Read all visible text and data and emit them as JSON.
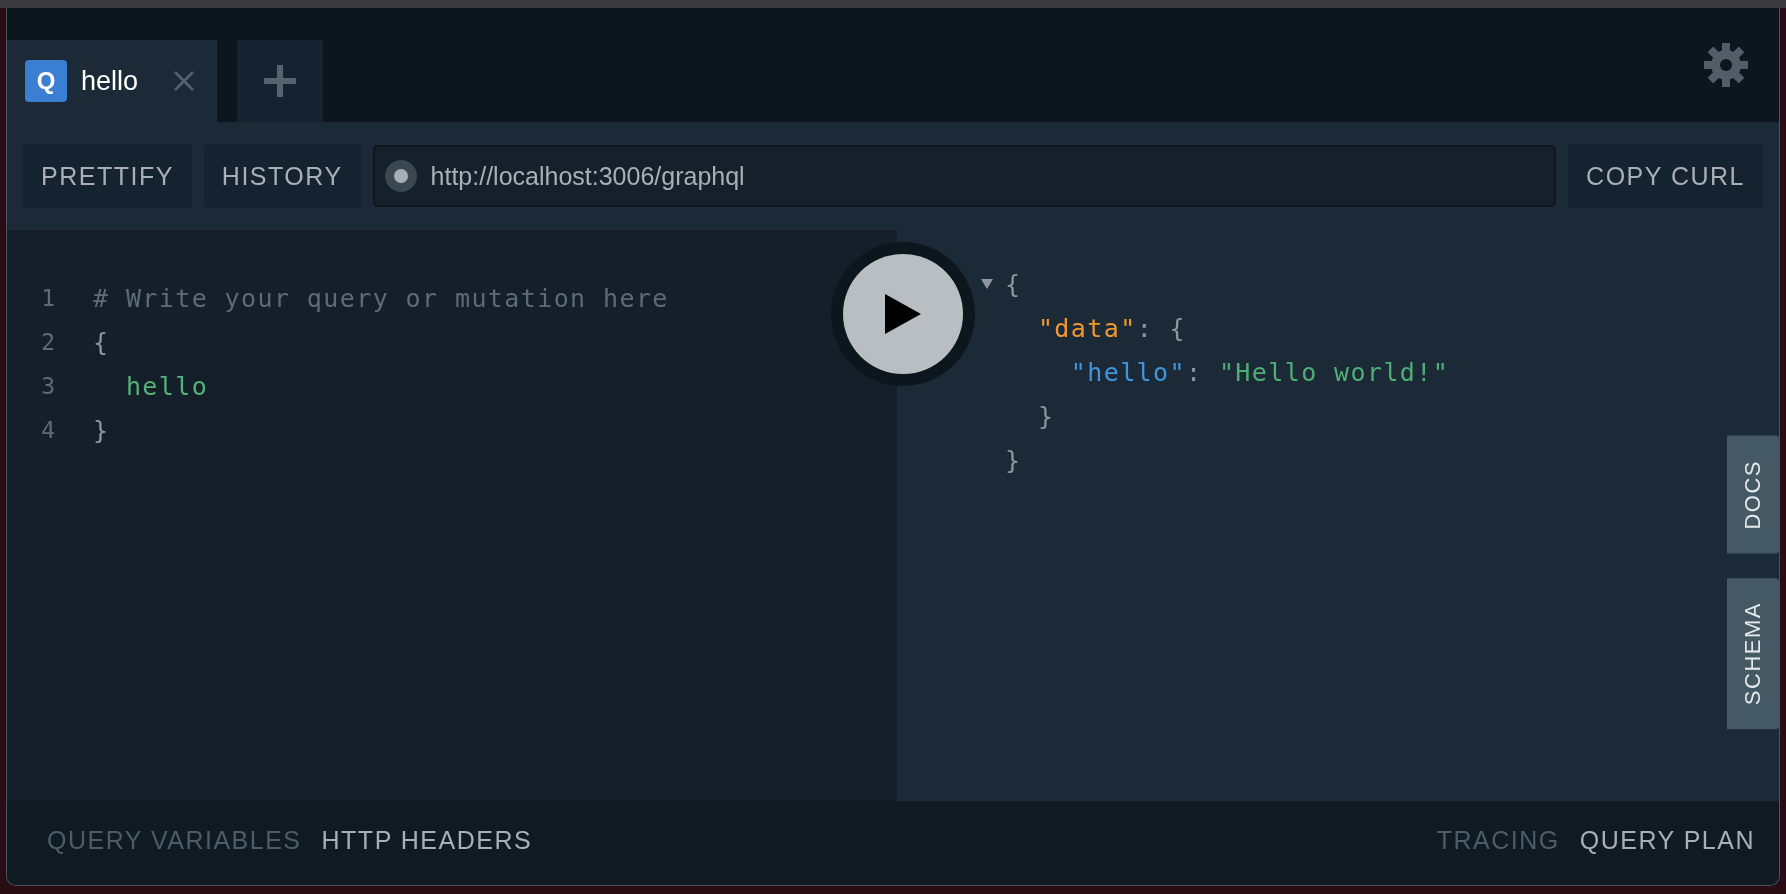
{
  "tabs": [
    {
      "badge": "Q",
      "title": "hello",
      "selected": true
    }
  ],
  "toolbar": {
    "buttons": [
      "PRETTIFY",
      "HISTORY"
    ],
    "endpoint": "http://localhost:3006/graphql",
    "copy_button": "COPY CURL"
  },
  "editor": {
    "lines": [
      {
        "number": "1",
        "tokens": [
          {
            "kind": "comment",
            "text": "# Write your query or mutation here"
          }
        ]
      },
      {
        "number": "2",
        "tokens": [
          {
            "kind": "punct",
            "text": "{"
          }
        ]
      },
      {
        "number": "3",
        "tokens": [
          {
            "kind": "field",
            "text": "  hello"
          }
        ]
      },
      {
        "number": "4",
        "tokens": [
          {
            "kind": "punct",
            "text": "}"
          }
        ]
      }
    ]
  },
  "result": {
    "lines": [
      {
        "foldable": true,
        "tokens": [
          {
            "kind": "punct",
            "text": "{"
          }
        ]
      },
      {
        "foldable": false,
        "tokens": [
          {
            "kind": "property",
            "text": "  \"data\""
          },
          {
            "kind": "punct",
            "text": ": {"
          }
        ]
      },
      {
        "foldable": false,
        "tokens": [
          {
            "kind": "key",
            "text": "    \"hello\""
          },
          {
            "kind": "punct",
            "text": ": "
          },
          {
            "kind": "string",
            "text": "\"Hello world!\""
          }
        ]
      },
      {
        "foldable": false,
        "tokens": [
          {
            "kind": "punct",
            "text": "  }"
          }
        ]
      },
      {
        "foldable": false,
        "tokens": [
          {
            "kind": "punct",
            "text": "}"
          }
        ]
      }
    ]
  },
  "side_tabs": [
    "DOCS",
    "SCHEMA"
  ],
  "bottom_bar": {
    "left": [
      {
        "label": "QUERY VARIABLES",
        "selected": false
      },
      {
        "label": "HTTP HEADERS",
        "selected": true
      }
    ],
    "right": [
      {
        "label": "TRACING",
        "selected": false
      },
      {
        "label": "QUERY PLAN",
        "selected": true
      }
    ]
  }
}
